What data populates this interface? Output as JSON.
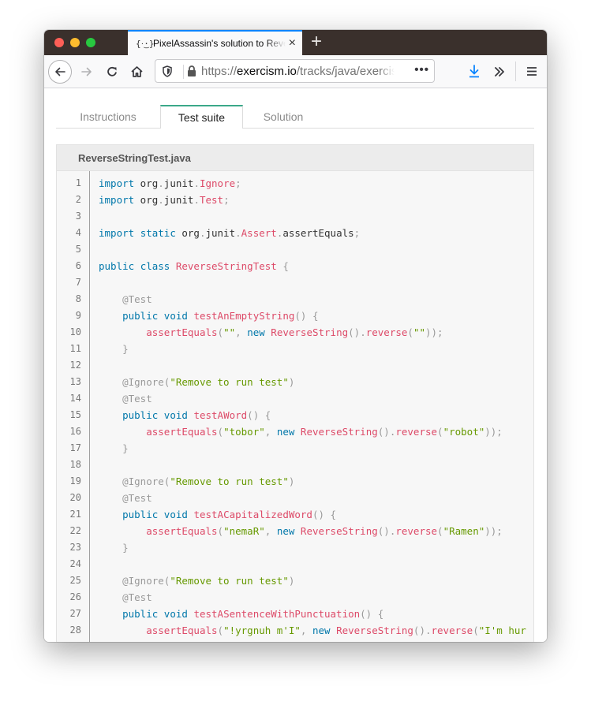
{
  "browser": {
    "tab": {
      "favicon": "{·͜·}",
      "title": "PixelAssassin's solution to Reverse String in Java on Exercism",
      "close_icon": "×"
    },
    "new_tab_icon": "+",
    "toolbar": {
      "back_icon": "←",
      "forward_icon": "→",
      "reload_icon": "↻",
      "home_icon": "⌂",
      "url_scheme": "https://",
      "url_host": "exercism.io",
      "url_path": "/tracks/java/exercises/reverse-string",
      "page_actions_icon": "•••",
      "downloads_icon": "⤓",
      "overflow_icon": "»",
      "menu_icon": "☰",
      "accent_color": "#0a84ff"
    }
  },
  "page": {
    "tabs": [
      {
        "label": "Instructions",
        "active": false
      },
      {
        "label": "Test suite",
        "active": true
      },
      {
        "label": "Solution",
        "active": false
      }
    ],
    "accent_color": "#3ba889",
    "code_file": {
      "filename": "ReverseStringTest.java",
      "lines": [
        [
          [
            "k",
            "import"
          ],
          [
            "t",
            " org"
          ],
          [
            "p",
            "."
          ],
          [
            "t",
            "junit"
          ],
          [
            "p",
            "."
          ],
          [
            "f",
            "Ignore"
          ],
          [
            "p",
            ";"
          ]
        ],
        [
          [
            "k",
            "import"
          ],
          [
            "t",
            " org"
          ],
          [
            "p",
            "."
          ],
          [
            "t",
            "junit"
          ],
          [
            "p",
            "."
          ],
          [
            "f",
            "Test"
          ],
          [
            "p",
            ";"
          ]
        ],
        [],
        [
          [
            "k",
            "import"
          ],
          [
            "t",
            " "
          ],
          [
            "k",
            "static"
          ],
          [
            "t",
            " org"
          ],
          [
            "p",
            "."
          ],
          [
            "t",
            "junit"
          ],
          [
            "p",
            "."
          ],
          [
            "f",
            "Assert"
          ],
          [
            "p",
            "."
          ],
          [
            "t",
            "assertEquals"
          ],
          [
            "p",
            ";"
          ]
        ],
        [],
        [
          [
            "k",
            "public"
          ],
          [
            "t",
            " "
          ],
          [
            "k",
            "class"
          ],
          [
            "t",
            " "
          ],
          [
            "f",
            "ReverseStringTest"
          ],
          [
            "t",
            " "
          ],
          [
            "p",
            "{"
          ]
        ],
        [],
        [
          [
            "t",
            "    "
          ],
          [
            "a",
            "@Test"
          ]
        ],
        [
          [
            "t",
            "    "
          ],
          [
            "k",
            "public"
          ],
          [
            "t",
            " "
          ],
          [
            "k",
            "void"
          ],
          [
            "t",
            " "
          ],
          [
            "f",
            "testAnEmptyString"
          ],
          [
            "p",
            "()"
          ],
          [
            "t",
            " "
          ],
          [
            "p",
            "{"
          ]
        ],
        [
          [
            "t",
            "        "
          ],
          [
            "f",
            "assertEquals"
          ],
          [
            "p",
            "("
          ],
          [
            "s",
            "\"\""
          ],
          [
            "p",
            ","
          ],
          [
            "t",
            " "
          ],
          [
            "k",
            "new"
          ],
          [
            "t",
            " "
          ],
          [
            "f",
            "ReverseString"
          ],
          [
            "p",
            "()."
          ],
          [
            "f",
            "reverse"
          ],
          [
            "p",
            "("
          ],
          [
            "s",
            "\"\""
          ],
          [
            "p",
            "));"
          ]
        ],
        [
          [
            "t",
            "    "
          ],
          [
            "p",
            "}"
          ]
        ],
        [],
        [
          [
            "t",
            "    "
          ],
          [
            "a",
            "@Ignore("
          ],
          [
            "s",
            "\"Remove to run test\""
          ],
          [
            "a",
            ")"
          ]
        ],
        [
          [
            "t",
            "    "
          ],
          [
            "a",
            "@Test"
          ]
        ],
        [
          [
            "t",
            "    "
          ],
          [
            "k",
            "public"
          ],
          [
            "t",
            " "
          ],
          [
            "k",
            "void"
          ],
          [
            "t",
            " "
          ],
          [
            "f",
            "testAWord"
          ],
          [
            "p",
            "()"
          ],
          [
            "t",
            " "
          ],
          [
            "p",
            "{"
          ]
        ],
        [
          [
            "t",
            "        "
          ],
          [
            "f",
            "assertEquals"
          ],
          [
            "p",
            "("
          ],
          [
            "s",
            "\"tobor\""
          ],
          [
            "p",
            ","
          ],
          [
            "t",
            " "
          ],
          [
            "k",
            "new"
          ],
          [
            "t",
            " "
          ],
          [
            "f",
            "ReverseString"
          ],
          [
            "p",
            "()."
          ],
          [
            "f",
            "reverse"
          ],
          [
            "p",
            "("
          ],
          [
            "s",
            "\"robot\""
          ],
          [
            "p",
            "));"
          ]
        ],
        [
          [
            "t",
            "    "
          ],
          [
            "p",
            "}"
          ]
        ],
        [],
        [
          [
            "t",
            "    "
          ],
          [
            "a",
            "@Ignore("
          ],
          [
            "s",
            "\"Remove to run test\""
          ],
          [
            "a",
            ")"
          ]
        ],
        [
          [
            "t",
            "    "
          ],
          [
            "a",
            "@Test"
          ]
        ],
        [
          [
            "t",
            "    "
          ],
          [
            "k",
            "public"
          ],
          [
            "t",
            " "
          ],
          [
            "k",
            "void"
          ],
          [
            "t",
            " "
          ],
          [
            "f",
            "testACapitalizedWord"
          ],
          [
            "p",
            "()"
          ],
          [
            "t",
            " "
          ],
          [
            "p",
            "{"
          ]
        ],
        [
          [
            "t",
            "        "
          ],
          [
            "f",
            "assertEquals"
          ],
          [
            "p",
            "("
          ],
          [
            "s",
            "\"nemaR\""
          ],
          [
            "p",
            ","
          ],
          [
            "t",
            " "
          ],
          [
            "k",
            "new"
          ],
          [
            "t",
            " "
          ],
          [
            "f",
            "ReverseString"
          ],
          [
            "p",
            "()."
          ],
          [
            "f",
            "reverse"
          ],
          [
            "p",
            "("
          ],
          [
            "s",
            "\"Ramen\""
          ],
          [
            "p",
            "));"
          ]
        ],
        [
          [
            "t",
            "    "
          ],
          [
            "p",
            "}"
          ]
        ],
        [],
        [
          [
            "t",
            "    "
          ],
          [
            "a",
            "@Ignore("
          ],
          [
            "s",
            "\"Remove to run test\""
          ],
          [
            "a",
            ")"
          ]
        ],
        [
          [
            "t",
            "    "
          ],
          [
            "a",
            "@Test"
          ]
        ],
        [
          [
            "t",
            "    "
          ],
          [
            "k",
            "public"
          ],
          [
            "t",
            " "
          ],
          [
            "k",
            "void"
          ],
          [
            "t",
            " "
          ],
          [
            "f",
            "testASentenceWithPunctuation"
          ],
          [
            "p",
            "()"
          ],
          [
            "t",
            " "
          ],
          [
            "p",
            "{"
          ]
        ],
        [
          [
            "t",
            "        "
          ],
          [
            "f",
            "assertEquals"
          ],
          [
            "p",
            "("
          ],
          [
            "s",
            "\"!yrgnuh m'I\""
          ],
          [
            "p",
            ","
          ],
          [
            "t",
            " "
          ],
          [
            "k",
            "new"
          ],
          [
            "t",
            " "
          ],
          [
            "f",
            "ReverseString"
          ],
          [
            "p",
            "()."
          ],
          [
            "f",
            "reverse"
          ],
          [
            "p",
            "("
          ],
          [
            "s",
            "\"I'm hur"
          ]
        ],
        [
          [
            "t",
            "    "
          ],
          [
            "p",
            "}"
          ]
        ]
      ],
      "syntax_colors": {
        "keyword": "#0077aa",
        "function": "#dd4a68",
        "string": "#669900",
        "punctuation": "#999999"
      }
    }
  }
}
